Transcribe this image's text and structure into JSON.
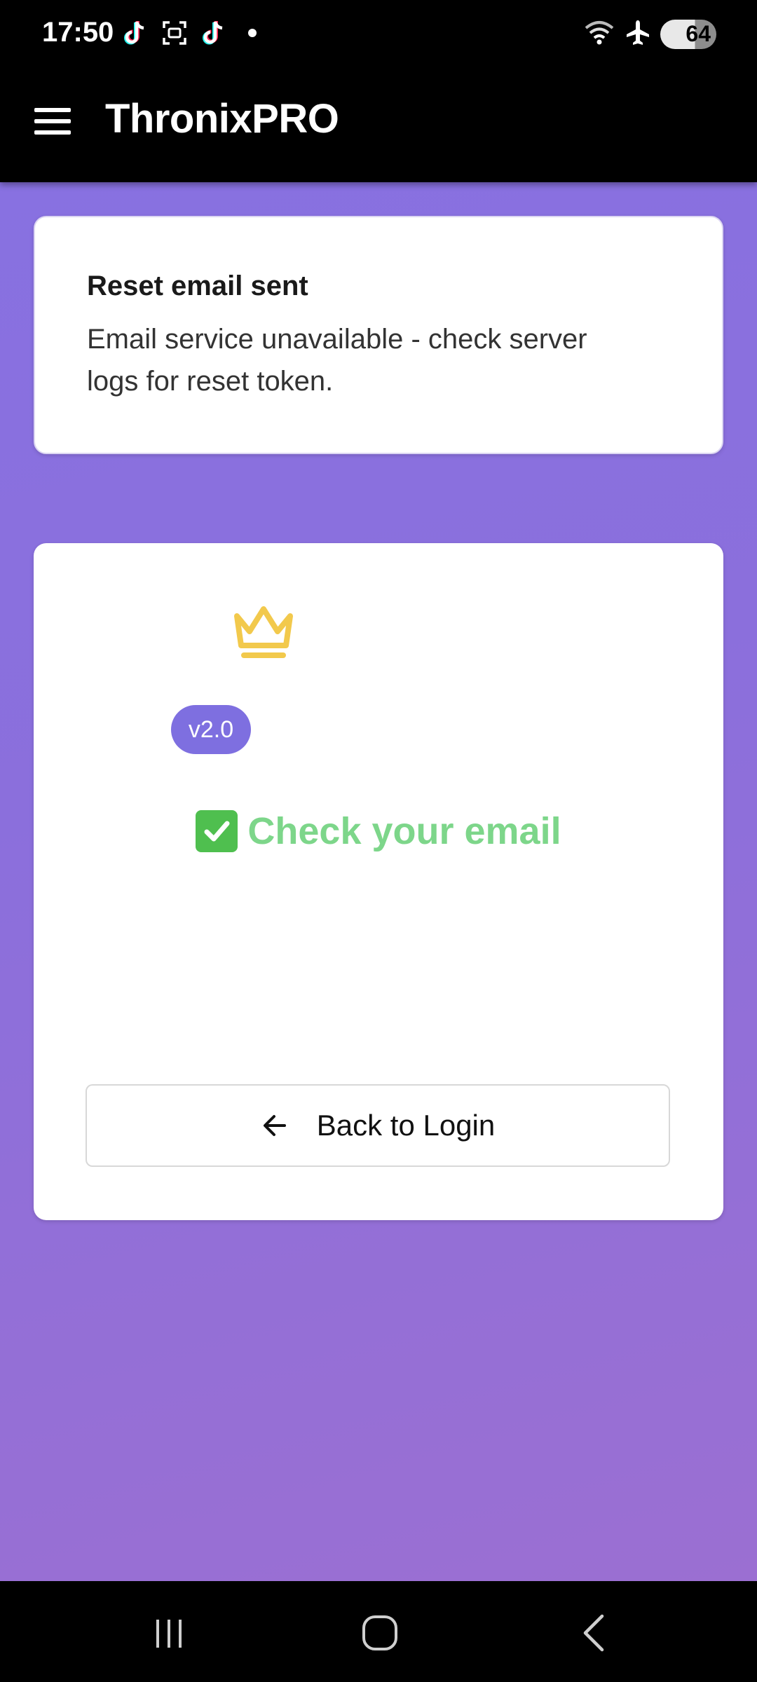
{
  "status_bar": {
    "time": "17:50",
    "battery": "64",
    "left_icons": [
      "tiktok-icon",
      "screenshot-icon",
      "tiktok-icon",
      "notification-dot"
    ],
    "right_icons": [
      "wifi-icon",
      "airplane-mode-icon",
      "battery-icon"
    ]
  },
  "app_bar": {
    "title": "ThronixPRO",
    "menu_icon": "hamburger-menu-icon"
  },
  "alert": {
    "title": "Reset email sent",
    "message": "Email service unavailable - check server logs for reset token."
  },
  "main_card": {
    "logo_icon": "crown-icon",
    "version": "v2.0",
    "heading": "Check your email",
    "heading_icon": "check-mark-icon",
    "back_button": "Back to Login"
  },
  "nav_bar": {
    "buttons": [
      "recent-apps",
      "home",
      "back"
    ]
  },
  "colors": {
    "background_start": "#8871e1",
    "background_end": "#9b6fd2",
    "badge": "#7e6fe0",
    "crown": "#f2c94c",
    "success_text": "#7dd68a",
    "app_bar": "#000000"
  }
}
